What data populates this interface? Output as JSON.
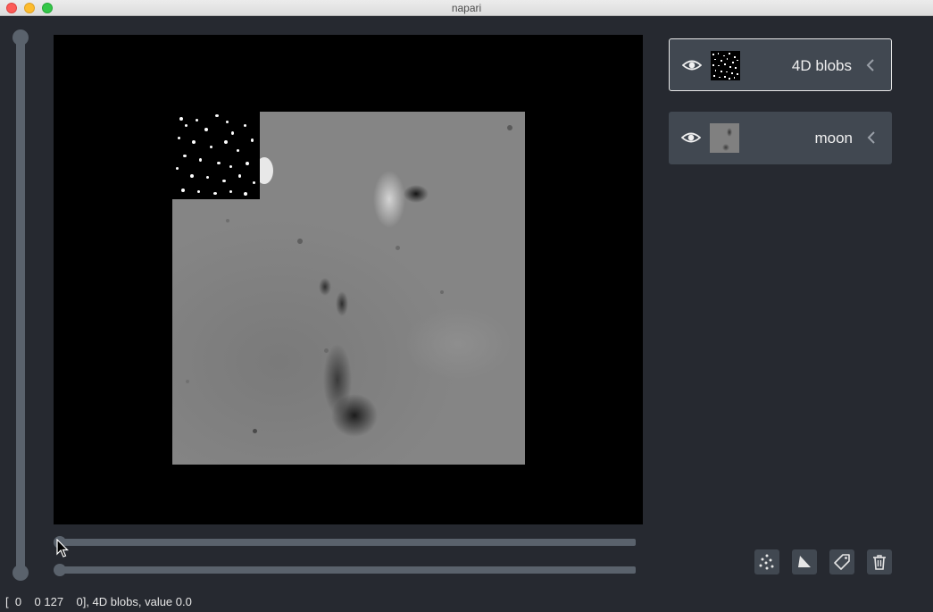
{
  "window": {
    "title": "napari"
  },
  "layers": [
    {
      "name": "4D blobs",
      "visible": true,
      "selected": true,
      "thumbnail": "blobs-thumbnail"
    },
    {
      "name": "moon",
      "visible": true,
      "selected": false,
      "thumbnail": "moon-thumbnail"
    }
  ],
  "layer_buttons": [
    {
      "icon": "new-points-icon"
    },
    {
      "icon": "new-shapes-icon"
    },
    {
      "icon": "new-labels-icon"
    },
    {
      "icon": "delete-layer-icon"
    }
  ],
  "dims_sliders": [
    {
      "axis": 0,
      "value": 0
    },
    {
      "axis": 1,
      "value": 0
    }
  ],
  "contrast_slider": {
    "value": 1.0
  },
  "status": {
    "text": "[  0    0 127    0], 4D blobs, value 0.0"
  },
  "colors": {
    "background": "#262930",
    "panel": "#414851",
    "slider": "#5a626c",
    "canvas": "#000000"
  }
}
